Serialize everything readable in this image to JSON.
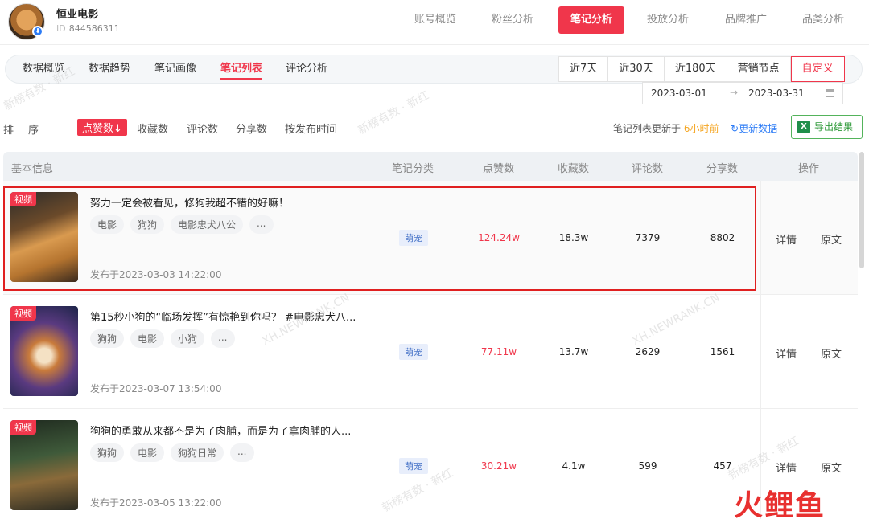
{
  "account": {
    "name": "恒业电影",
    "id_label": "ID",
    "id_value": "844586311"
  },
  "topnav": [
    "账号概览",
    "粉丝分析",
    "笔记分析",
    "投放分析",
    "品牌推广",
    "品类分析"
  ],
  "subtabs": [
    "数据概览",
    "数据趋势",
    "笔记画像",
    "笔记列表",
    "评论分析"
  ],
  "date_ranges": [
    "近7天",
    "近30天",
    "近180天",
    "营销节点",
    "自定义"
  ],
  "date_picker": {
    "start": "2023-03-01",
    "arrow": "→",
    "end": "2023-03-31"
  },
  "sort": {
    "label": "排序",
    "items": [
      "点赞数↓",
      "收藏数",
      "评论数",
      "分享数",
      "按发布时间"
    ]
  },
  "update": {
    "prefix": "笔记列表更新于",
    "time": "6小时前",
    "refresh": "更新数据"
  },
  "export": {
    "icon_text": "X",
    "label": "导出结果"
  },
  "table_header": [
    "基本信息",
    "笔记分类",
    "点赞数",
    "收藏数",
    "评论数",
    "分享数",
    "操作"
  ],
  "rows": [
    {
      "badge": "视频",
      "title": "努力一定会被看见，修狗我超不错的好嘛！",
      "tags": [
        "电影",
        "狗狗",
        "电影忠犬八公",
        "..."
      ],
      "date": "发布于2023-03-03 14:22:00",
      "category": "萌宠",
      "likes": "124.24w",
      "favorites": "18.3w",
      "comments": "7379",
      "shares": "8802",
      "op_detail": "详情",
      "op_source": "原文"
    },
    {
      "badge": "视频",
      "title": "第15秒小狗的“临场发挥”有惊艳到你吗？ #电影忠犬八...",
      "tags": [
        "狗狗",
        "电影",
        "小狗",
        "..."
      ],
      "date": "发布于2023-03-07 13:54:00",
      "category": "萌宠",
      "likes": "77.11w",
      "favorites": "13.7w",
      "comments": "2629",
      "shares": "1561",
      "op_detail": "详情",
      "op_source": "原文"
    },
    {
      "badge": "视频",
      "title": "狗狗的勇敢从来都不是为了肉脯，而是为了拿肉脯的人...",
      "tags": [
        "狗狗",
        "电影",
        "狗狗日常",
        "..."
      ],
      "date": "发布于2023-03-05 13:22:00",
      "category": "萌宠",
      "likes": "30.21w",
      "favorites": "4.1w",
      "comments": "599",
      "shares": "457",
      "op_detail": "详情",
      "op_source": "原文"
    }
  ],
  "watermarks": [
    "新榜有数 · 新红",
    "XH.NEWRANK.CN"
  ],
  "brand_logo": "火鲤鱼",
  "colors": {
    "accent": "#f0364b",
    "link": "#2d7cf6",
    "export_green": "#2f9a3a",
    "category_blue": "#4a76c9"
  }
}
